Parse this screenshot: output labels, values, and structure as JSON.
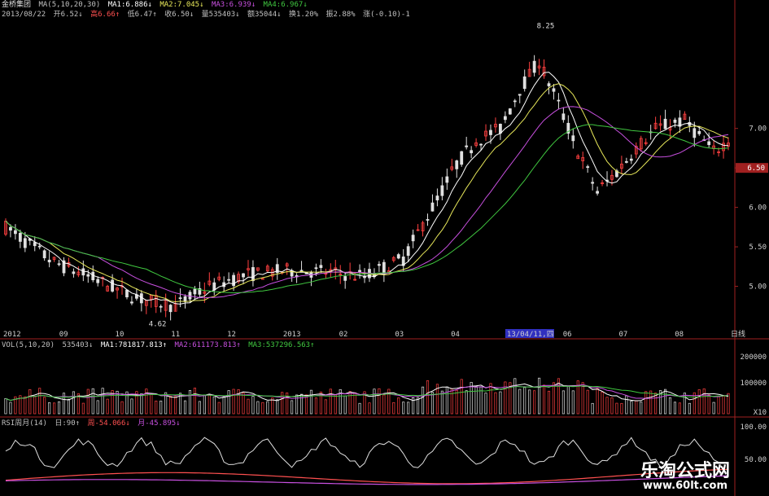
{
  "header": {
    "stock_name": "金桥集团",
    "indicator": "MA(5,10,20,30)",
    "ma1": "MA1:6.886↓",
    "ma2": "MA2:7.045↓",
    "ma3": "MA3:6.939↓",
    "ma4": "MA4:6.967↓",
    "date": "2013/08/22",
    "open": "开6.52↓",
    "high": "高6.66↑",
    "low": "低6.47↑",
    "close": "收6.50↓",
    "vol": "量535403↓",
    "amount": "额35044↓",
    "turnover": "换1.20%",
    "amplitude": "振2.88%",
    "change": "涨(-0.10)-1"
  },
  "vol_header": {
    "indicator": "VOL(5,10,20)",
    "value": "535403↓",
    "ma1": "MA1:781817.813↑",
    "ma2": "MA2:611173.813↑",
    "ma3": "MA3:537296.563↑"
  },
  "osc_header": {
    "name": "RSI周月(14)",
    "day": "日:90↑",
    "week": "周-54.066↓",
    "month": "月-45.895↓"
  },
  "watermark": {
    "title": "乐淘公式网",
    "url": "www.60lt.com"
  },
  "colors": {
    "background": "#000000",
    "up": "#ff4040",
    "down": "#e0e0e0",
    "ma1": "#ffffff",
    "ma2": "#e8e85a",
    "ma3": "#c850e0",
    "ma4": "#40c840",
    "axis": "#a02020",
    "date_badge": "#3030c0"
  },
  "chart_data": [
    {
      "type": "candlestick",
      "name": "price",
      "yticks": [
        "7.00",
        "6.50",
        "6.00",
        "5.50",
        "5.00"
      ],
      "ylim": [
        4.5,
        8.4
      ],
      "current_price": "6.50",
      "xticks": [
        "2012",
        "09",
        "10",
        "11",
        "12",
        "2013",
        "02",
        "03",
        "04",
        "13/04/11,四",
        "06",
        "07",
        "08",
        "日线"
      ],
      "annotations": [
        "8.25",
        "4.62"
      ],
      "high_value": 8.25,
      "low_value": 4.62,
      "ma_lines": [
        "MA1",
        "MA2",
        "MA3",
        "MA4"
      ]
    },
    {
      "type": "bar",
      "name": "volume",
      "yticks": [
        "200000",
        "100000",
        "X10"
      ],
      "ylim": [
        0,
        240000
      ]
    },
    {
      "type": "line",
      "name": "oscillator",
      "yticks": [
        "100.00",
        "50.00"
      ],
      "ylim": [
        0,
        100
      ]
    }
  ]
}
